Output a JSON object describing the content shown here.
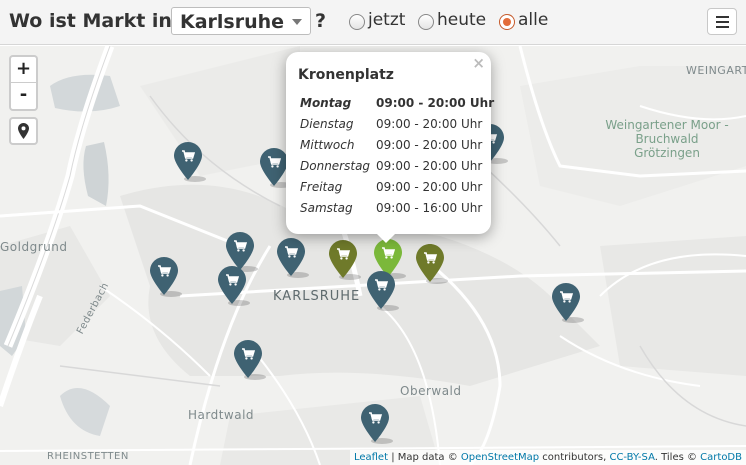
{
  "header": {
    "title": "Wo ist Markt in",
    "city": "Karlsruhe",
    "question_mark": "?",
    "filters": [
      {
        "label": "jetzt",
        "selected": false
      },
      {
        "label": "heute",
        "selected": false
      },
      {
        "label": "alle",
        "selected": true
      }
    ],
    "menu_icon": "hamburger-menu-icon"
  },
  "map": {
    "zoom_in": "+",
    "zoom_out": "-",
    "locate_icon": "map-pin-icon",
    "places": {
      "city": "KARLSRUHE",
      "weingarten": "WEINGART",
      "moor": "Weingartener Moor -\nBruchwald\nGrötzingen",
      "goldgrund": "Goldgrund",
      "federbach": "Federbach",
      "oberwald": "Oberwald",
      "hardtwald": "Hardtwald",
      "rheinstetten": "RHEINSTETTEN"
    },
    "marker_icon": "shopping-cart-icon",
    "colors": {
      "marker_default": "#3f6272",
      "marker_today": "#6f7a2a",
      "marker_selected": "#7bb83a",
      "radio_selected": "#e36d3a"
    },
    "markers": [
      {
        "state": "default"
      },
      {
        "state": "default"
      },
      {
        "state": "default"
      },
      {
        "state": "default"
      },
      {
        "state": "default"
      },
      {
        "state": "default"
      },
      {
        "state": "default"
      },
      {
        "state": "today"
      },
      {
        "state": "selected"
      },
      {
        "state": "today"
      },
      {
        "state": "default"
      },
      {
        "state": "default"
      },
      {
        "state": "default"
      },
      {
        "state": "default"
      }
    ]
  },
  "popup": {
    "title": "Kronenplatz",
    "close": "×",
    "schedule": [
      {
        "day": "Montag",
        "time": "09:00 - 20:00 Uhr",
        "today": true
      },
      {
        "day": "Dienstag",
        "time": "09:00 - 20:00 Uhr",
        "today": false
      },
      {
        "day": "Mittwoch",
        "time": "09:00 - 20:00 Uhr",
        "today": false
      },
      {
        "day": "Donnerstag",
        "time": "09:00 - 20:00 Uhr",
        "today": false
      },
      {
        "day": "Freitag",
        "time": "09:00 - 20:00 Uhr",
        "today": false
      },
      {
        "day": "Samstag",
        "time": "09:00 - 16:00 Uhr",
        "today": false
      }
    ]
  },
  "attribution": {
    "leaflet": "Leaflet",
    "sep": " | Map data © ",
    "osm": "OpenStreetMap",
    "contributors": " contributors, ",
    "license": "CC-BY-SA",
    "tiles": ". Tiles © ",
    "cartodb": "CartoDB"
  }
}
